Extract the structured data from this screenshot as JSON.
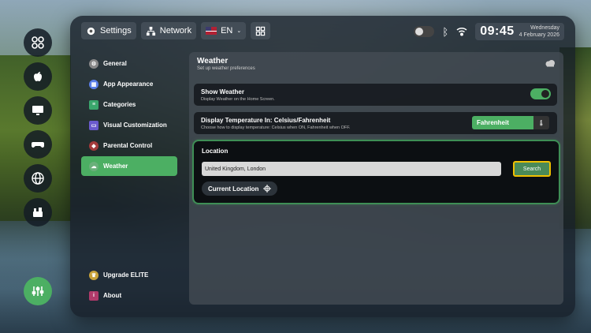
{
  "topbar": {
    "settings_label": "Settings",
    "network_label": "Network",
    "language_label": "EN"
  },
  "status": {
    "time": "09:45",
    "day": "Wednesday",
    "date": "4 February 2026"
  },
  "menu": {
    "items": [
      {
        "label": "General",
        "icon": "gear-icon",
        "color": "#888888"
      },
      {
        "label": "App Appearance",
        "icon": "grid-icon",
        "color": "#5a7ee8"
      },
      {
        "label": "Categories",
        "icon": "list-icon",
        "color": "#3aa66c"
      },
      {
        "label": "Visual Customization",
        "icon": "palette-icon",
        "color": "#6a5acd"
      },
      {
        "label": "Parental Control",
        "icon": "shield-icon",
        "color": "#a33a3a"
      },
      {
        "label": "Weather",
        "icon": "cloud-icon",
        "color": "#6ab07a"
      }
    ],
    "bottom": [
      {
        "label": "Upgrade ELITE",
        "icon": "crown-icon",
        "color": "#c8a23a"
      },
      {
        "label": "About",
        "icon": "info-icon",
        "color": "#b03a6a"
      }
    ],
    "active": "Weather"
  },
  "panel": {
    "title": "Weather",
    "subtitle": "Set up weather preferences",
    "show_weather": {
      "title": "Show Weather",
      "desc": "Display Weather on the Home Screen.",
      "enabled": true
    },
    "temperature": {
      "title": "Display Temperature In: Celsius/Fahrenheit",
      "desc": "Choose how to display temperature: Celsius when ON, Fahrenheit when OFF.",
      "selected": "Fahrenheit"
    },
    "location": {
      "title": "Location",
      "value": "United Kingdom, London",
      "search_label": "Search",
      "current_label": "Current Location"
    }
  },
  "colors": {
    "accent": "#4caf63",
    "focus": "#f0c000"
  }
}
